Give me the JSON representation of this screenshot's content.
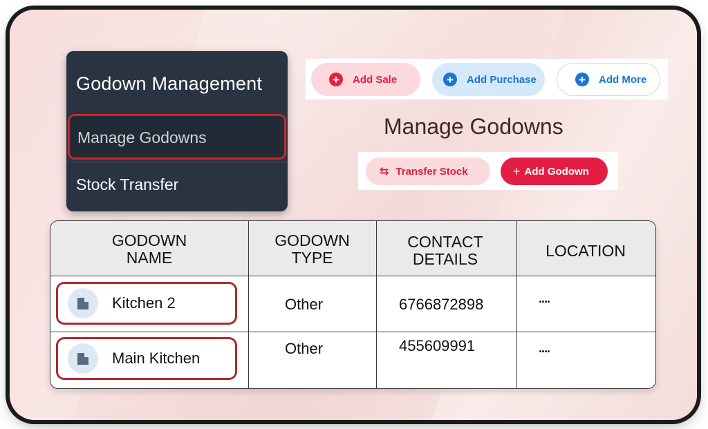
{
  "sidebar": {
    "title": "Godown Management",
    "items": [
      {
        "label": "Manage Godowns",
        "active": true
      },
      {
        "label": "Stock Transfer",
        "active": false
      }
    ]
  },
  "top_actions": {
    "add_sale": "Add Sale",
    "add_purchase": "Add Purchase",
    "add_more": "Add More"
  },
  "page_title": "Manage Godowns",
  "page_actions": {
    "transfer_stock": "Transfer Stock",
    "add_godown": "Add Godown"
  },
  "table": {
    "headers": [
      {
        "line1": "GODOWN",
        "line2": "NAME"
      },
      {
        "line1": "GODOWN",
        "line2": "TYPE"
      },
      {
        "line1": "CONTACT",
        "line2": "DETAILS"
      },
      {
        "line1": "LOCATION",
        "line2": ""
      }
    ],
    "rows": [
      {
        "name": "Kitchen 2",
        "type": "Other",
        "contact": "6766872898",
        "location": "...."
      },
      {
        "name": "Main Kitchen",
        "type": "Other",
        "contact": "455609991",
        "location": "...."
      }
    ]
  },
  "colors": {
    "sidebar_bg": "#2a3341",
    "accent_red": "#e41e43",
    "accent_blue": "#1976d2",
    "highlight_border": "#b0282f"
  },
  "icons": {
    "add": "plus-circle-icon",
    "transfer": "swap-arrows-icon",
    "building": "building-icon"
  }
}
